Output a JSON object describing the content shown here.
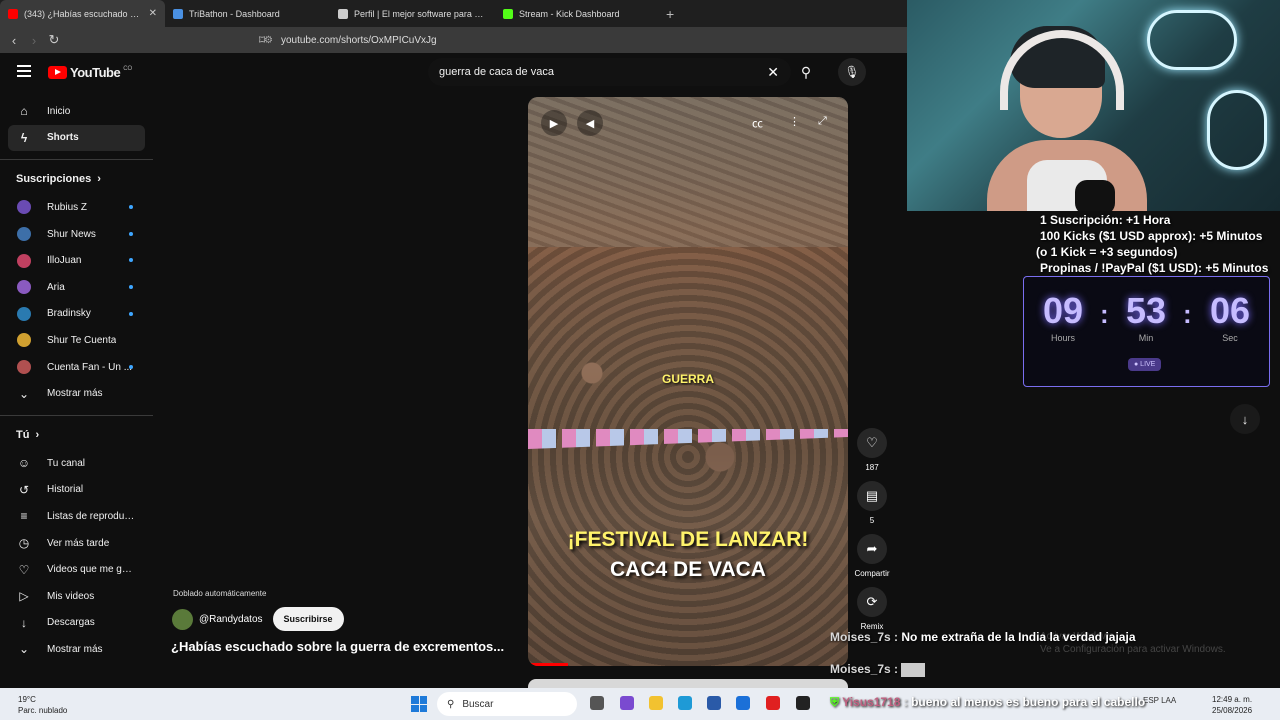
{
  "browser": {
    "tabs": [
      {
        "title": "(343) ¿Habías escuchado sobre la",
        "active": true,
        "color": "#ff0000"
      },
      {
        "title": "TriBathon - Dashboard",
        "active": false,
        "color": "#4a90e2"
      },
      {
        "title": "Perfil | El mejor software para potenc",
        "active": false,
        "color": "#cccccc"
      },
      {
        "title": "Stream - Kick Dashboard",
        "active": false,
        "color": "#53fc18"
      }
    ],
    "url": "youtube.com/shorts/OxMPICuVxJg"
  },
  "youtube": {
    "logo_text": "YouTube",
    "country_code": "CO",
    "search_value": "guerra de caca de vaca"
  },
  "sidebar": {
    "main": [
      {
        "label": "Inicio",
        "icon": "home-icon",
        "glyph": "⌂"
      },
      {
        "label": "Shorts",
        "icon": "shorts-icon",
        "glyph": "ϟ"
      }
    ],
    "subscriptions_title": "Suscripciones",
    "subscriptions": [
      {
        "label": "Rubius Z",
        "color": "#6a4bb3"
      },
      {
        "label": "Shur News",
        "color": "#3d6fa8"
      },
      {
        "label": "IlloJuan",
        "color": "#c04060"
      },
      {
        "label": "Aria",
        "color": "#8a5ac0"
      },
      {
        "label": "Bradinsky",
        "color": "#2a7ab0"
      },
      {
        "label": "Shur Te Cuenta",
        "color": "#d0a030"
      },
      {
        "label": "Cuenta Fan - Un ...",
        "color": "#b05050"
      }
    ],
    "show_more": "Mostrar más",
    "you_title": "Tú",
    "you": [
      {
        "label": "Tu canal",
        "icon": "channel-icon",
        "glyph": "☺"
      },
      {
        "label": "Historial",
        "icon": "history-icon",
        "glyph": "↺"
      },
      {
        "label": "Listas de reproducc...",
        "icon": "playlists-icon",
        "glyph": "≡"
      },
      {
        "label": "Ver más tarde",
        "icon": "watch-later-icon",
        "glyph": "◷"
      },
      {
        "label": "Videos que me gus...",
        "icon": "like-icon",
        "glyph": "♡"
      },
      {
        "label": "Mis videos",
        "icon": "my-videos-icon",
        "glyph": "▷"
      },
      {
        "label": "Descargas",
        "icon": "download-icon",
        "glyph": "↓"
      },
      {
        "label": "Mostrar más",
        "icon": "chevron-down-icon",
        "glyph": "⌄"
      }
    ]
  },
  "video": {
    "caption_small": "GUERRA",
    "caption_line1": "¡FESTIVAL DE LANZAR!",
    "caption_line2": "CAC4 DE VACA",
    "dubbed": "Doblado automáticamente",
    "channel": "@Randydatos",
    "subscribe": "Suscribirse",
    "title": "¿Habías escuchado sobre la guerra de excrementos..."
  },
  "actions": {
    "likes": "187",
    "comments": "5",
    "share": "Compartir",
    "remix": "Remix"
  },
  "stream": {
    "info_lines": [
      "1 Suscripción: +1 Hora",
      "100 Kicks ($1 USD approx): +5 Minutos",
      "(o 1 Kick = +3 segundos)",
      "Propinas / !PayPal ($1 USD): +5 Minutos"
    ],
    "timer": {
      "hours": "09",
      "minutes": "53",
      "seconds": "06",
      "hours_label": "Hours",
      "minutes_label": "Min",
      "seconds_label": "Sec",
      "live": "● LIVE"
    },
    "chat": [
      {
        "user": "Moises_7s",
        "message": "No me extraña de la India la verdad jajaja"
      },
      {
        "user": "Moises_7s",
        "message": ""
      },
      {
        "user": "Yisus1718",
        "message": "bueno al menos es bueno para el cabello"
      }
    ],
    "watermark": [
      "Activar Windows",
      "Ve a Configuración para activar Windows."
    ]
  },
  "taskbar": {
    "temp": "19°C",
    "weather": "Parc. nublado",
    "search": "Buscar",
    "lang1": "ESP",
    "lang2": "LAA",
    "time": "12:49 a. m.",
    "date": "25/08/2026"
  }
}
